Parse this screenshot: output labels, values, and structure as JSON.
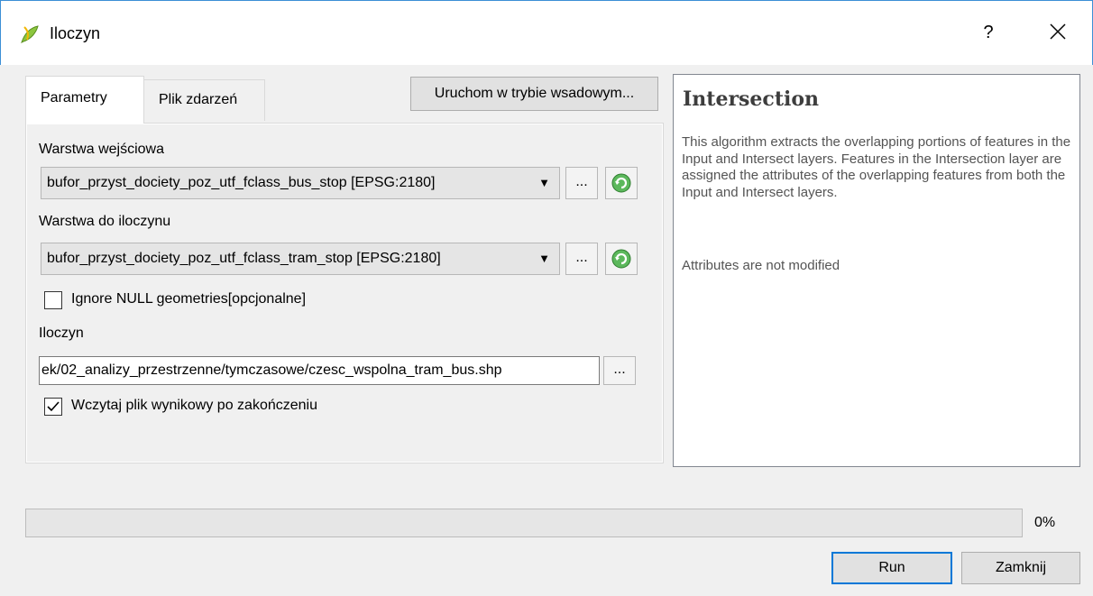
{
  "window": {
    "title": "Iloczyn",
    "help_label": "?",
    "close_label": "✕"
  },
  "tabs": [
    {
      "label": "Parametry",
      "active": true
    },
    {
      "label": "Plik zdarzeń",
      "active": false
    }
  ],
  "batch_button": "Uruchom w trybie wsadowym...",
  "form": {
    "input_layer": {
      "label": "Warstwa wejściowa",
      "value": "bufor_przyst_dociety_poz_utf_fclass_bus_stop [EPSG:2180]"
    },
    "overlay_layer": {
      "label": "Warstwa do iloczynu",
      "value": "bufor_przyst_dociety_poz_utf_fclass_tram_stop [EPSG:2180]"
    },
    "ellipsis_label": "...",
    "ignore_null": {
      "label": "Ignore NULL geometries[opcjonalne]",
      "checked": false
    },
    "output": {
      "label": "Iloczyn",
      "value": "ek/02_analizy_przestrzenne/tymczasowe/czesc_wspolna_tram_bus.shp"
    },
    "load_result": {
      "label": "Wczytaj plik wynikowy po zakończeniu",
      "checked": true
    }
  },
  "help": {
    "title": "Intersection",
    "description": "This algorithm extracts the overlapping portions of features in the Input and Intersect layers. Features in the Intersection layer are assigned the attributes of the overlapping features from both the Input and Intersect layers.",
    "note": "Attributes are not modified"
  },
  "progress": {
    "percent_value": 0,
    "text": "0%"
  },
  "buttons": {
    "run": "Run",
    "close": "Zamknij"
  },
  "colors": {
    "accent": "#0078d7",
    "window_border": "#3c8fd6",
    "progress_fill": "#06b025",
    "icon_green": "#3aa13a"
  },
  "icons": {
    "app": "qgis-leaf-icon",
    "refresh": "iterate-refresh-icon",
    "dropdown": "chevron-down-icon",
    "checkmark": "check-icon"
  }
}
